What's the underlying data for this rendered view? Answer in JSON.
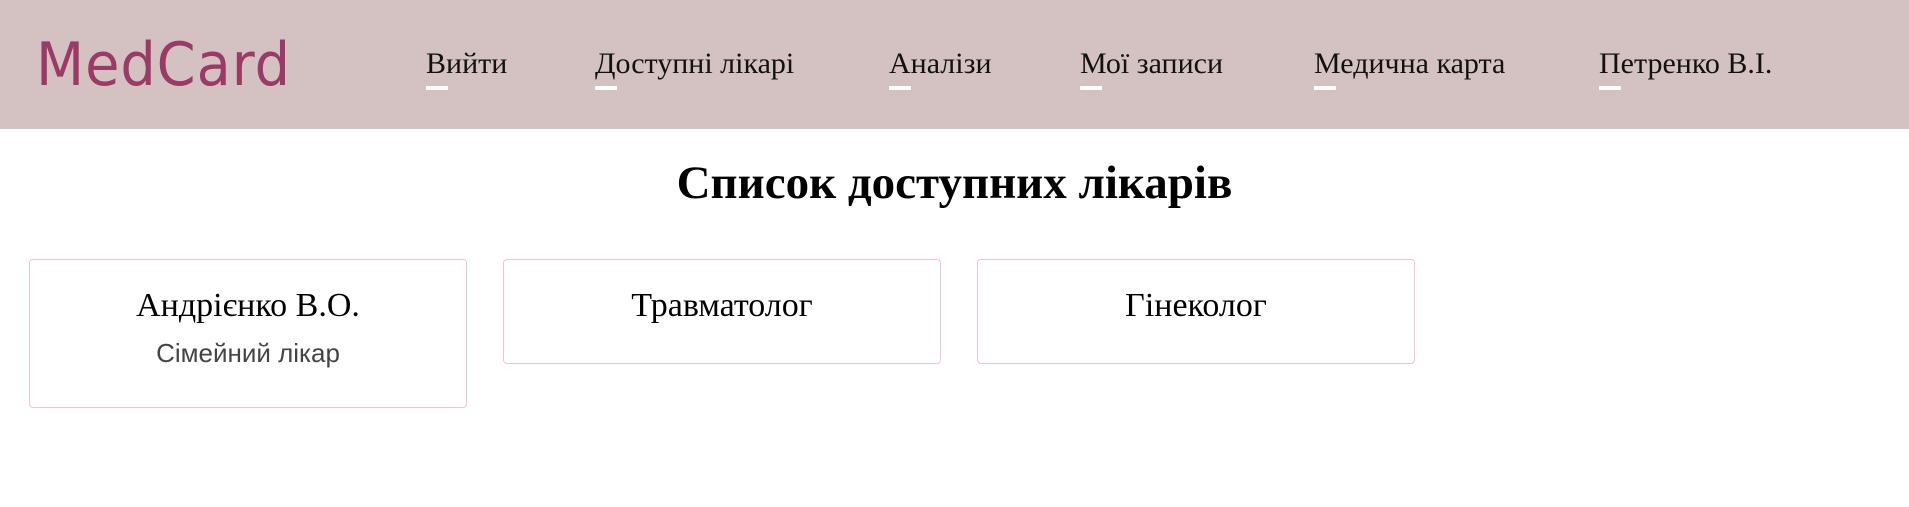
{
  "header": {
    "logo": "MedCard",
    "background_color": "#d4c1c1",
    "logo_color": "#9b3a66",
    "nav": [
      {
        "label": "Вийти"
      },
      {
        "label": "Доступні лікарі"
      },
      {
        "label": "Аналізи"
      },
      {
        "label": "Мої записи"
      },
      {
        "label": "Медична карта"
      },
      {
        "label": "Петренко В.І."
      }
    ]
  },
  "main": {
    "title": "Список доступних лікарів",
    "cards": [
      {
        "name": "Андрієнко В.О.",
        "specialty": "Сімейний лікар"
      },
      {
        "name": "Травматолог"
      },
      {
        "name": "Гінеколог"
      }
    ],
    "card_border_color": "#f4c3cc"
  }
}
